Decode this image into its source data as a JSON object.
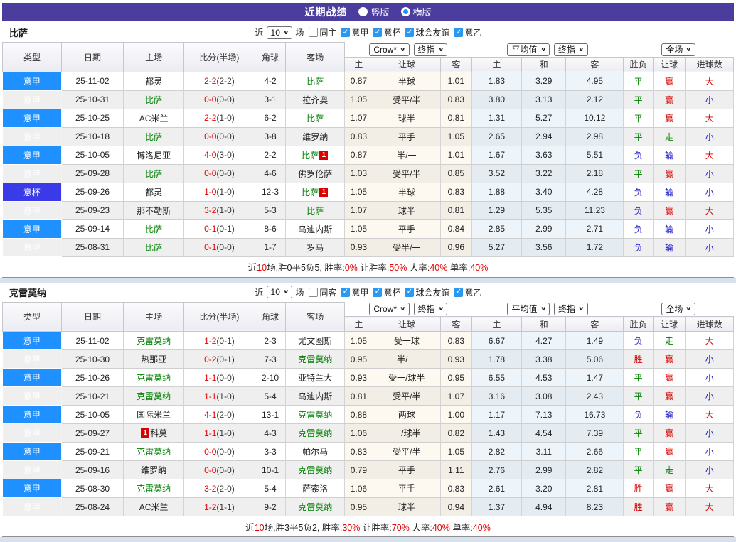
{
  "title_bar": {
    "title": "近期战绩",
    "options": [
      {
        "label": "竖版",
        "selected": false
      },
      {
        "label": "横版",
        "selected": true
      }
    ]
  },
  "colors": {
    "accent_purple": "#4a3d9e",
    "league_blue": "#1e90ff",
    "cup_blue": "#3a3ae8",
    "team_green": "#008000",
    "score_red": "#e60000",
    "win_red": "#d60000",
    "lose_blue": "#2323cc",
    "check_blue": "#2b99f0"
  },
  "table_header": {
    "main_cols": [
      "类型",
      "日期",
      "主场",
      "比分(半场)",
      "角球",
      "客场"
    ],
    "sub_cols": [
      "主",
      "让球",
      "客",
      "主",
      "和",
      "客",
      "胜负",
      "让球",
      "进球数"
    ],
    "selects": {
      "odds_source": "Crow*",
      "final1": "终指",
      "average": "平均值",
      "final2": "终指",
      "scope": "全场"
    }
  },
  "sections": [
    {
      "team": "比萨",
      "filter": {
        "near_label": "近",
        "count": "10",
        "games_label": "场",
        "same_label": "同主",
        "same_checked": false,
        "leagues": [
          "意甲",
          "意杯",
          "球会友谊",
          "意乙"
        ]
      },
      "rows": [
        {
          "type": "意甲",
          "cup": false,
          "date": "25-11-02",
          "home": "都灵",
          "home_green": false,
          "home_badge": "",
          "score": "2-2",
          "half": "(2-2)",
          "corner": "4-2",
          "away": "比萨",
          "away_green": true,
          "away_badge": "",
          "badge_pos": "after",
          "odds": [
            "0.87",
            "半球",
            "1.01"
          ],
          "avg": [
            "1.83",
            "3.29",
            "4.95"
          ],
          "res": [
            [
              "平",
              "g"
            ],
            [
              "赢",
              "r"
            ],
            [
              "大",
              "r"
            ]
          ]
        },
        {
          "type": "意甲",
          "cup": false,
          "date": "25-10-31",
          "home": "比萨",
          "home_green": true,
          "home_badge": "",
          "score": "0-0",
          "half": "(0-0)",
          "corner": "3-1",
          "away": "拉齐奥",
          "away_green": false,
          "away_badge": "",
          "badge_pos": "after",
          "odds": [
            "1.05",
            "受平/半",
            "0.83"
          ],
          "avg": [
            "3.80",
            "3.13",
            "2.12"
          ],
          "res": [
            [
              "平",
              "g"
            ],
            [
              "赢",
              "r"
            ],
            [
              "小",
              "b"
            ]
          ]
        },
        {
          "type": "意甲",
          "cup": false,
          "date": "25-10-25",
          "home": "AC米兰",
          "home_green": false,
          "home_badge": "",
          "score": "2-2",
          "half": "(1-0)",
          "corner": "6-2",
          "away": "比萨",
          "away_green": true,
          "away_badge": "",
          "badge_pos": "after",
          "odds": [
            "1.07",
            "球半",
            "0.81"
          ],
          "avg": [
            "1.31",
            "5.27",
            "10.12"
          ],
          "res": [
            [
              "平",
              "g"
            ],
            [
              "赢",
              "r"
            ],
            [
              "大",
              "r"
            ]
          ]
        },
        {
          "type": "意甲",
          "cup": false,
          "date": "25-10-18",
          "home": "比萨",
          "home_green": true,
          "home_badge": "",
          "score": "0-0",
          "half": "(0-0)",
          "corner": "3-8",
          "away": "维罗纳",
          "away_green": false,
          "away_badge": "",
          "badge_pos": "after",
          "odds": [
            "0.83",
            "平手",
            "1.05"
          ],
          "avg": [
            "2.65",
            "2.94",
            "2.98"
          ],
          "res": [
            [
              "平",
              "g"
            ],
            [
              "走",
              "g"
            ],
            [
              "小",
              "b"
            ]
          ]
        },
        {
          "type": "意甲",
          "cup": false,
          "date": "25-10-05",
          "home": "博洛尼亚",
          "home_green": false,
          "home_badge": "",
          "score": "4-0",
          "half": "(3-0)",
          "corner": "2-2",
          "away": "比萨",
          "away_green": true,
          "away_badge": "1",
          "badge_pos": "after",
          "odds": [
            "0.87",
            "半/一",
            "1.01"
          ],
          "avg": [
            "1.67",
            "3.63",
            "5.51"
          ],
          "res": [
            [
              "负",
              "b"
            ],
            [
              "输",
              "b"
            ],
            [
              "大",
              "r"
            ]
          ]
        },
        {
          "type": "意甲",
          "cup": false,
          "date": "25-09-28",
          "home": "比萨",
          "home_green": true,
          "home_badge": "",
          "score": "0-0",
          "half": "(0-0)",
          "corner": "4-6",
          "away": "佛罗伦萨",
          "away_green": false,
          "away_badge": "",
          "badge_pos": "after",
          "odds": [
            "1.03",
            "受平/半",
            "0.85"
          ],
          "avg": [
            "3.52",
            "3.22",
            "2.18"
          ],
          "res": [
            [
              "平",
              "g"
            ],
            [
              "赢",
              "r"
            ],
            [
              "小",
              "b"
            ]
          ]
        },
        {
          "type": "意杯",
          "cup": true,
          "date": "25-09-26",
          "home": "都灵",
          "home_green": false,
          "home_badge": "",
          "score": "1-0",
          "half": "(1-0)",
          "corner": "12-3",
          "away": "比萨",
          "away_green": true,
          "away_badge": "1",
          "badge_pos": "after",
          "odds": [
            "1.05",
            "半球",
            "0.83"
          ],
          "avg": [
            "1.88",
            "3.40",
            "4.28"
          ],
          "res": [
            [
              "负",
              "b"
            ],
            [
              "输",
              "b"
            ],
            [
              "小",
              "b"
            ]
          ]
        },
        {
          "type": "意甲",
          "cup": false,
          "date": "25-09-23",
          "home": "那不勒斯",
          "home_green": false,
          "home_badge": "",
          "score": "3-2",
          "half": "(1-0)",
          "corner": "5-3",
          "away": "比萨",
          "away_green": true,
          "away_badge": "",
          "badge_pos": "after",
          "odds": [
            "1.07",
            "球半",
            "0.81"
          ],
          "avg": [
            "1.29",
            "5.35",
            "11.23"
          ],
          "res": [
            [
              "负",
              "b"
            ],
            [
              "赢",
              "r"
            ],
            [
              "大",
              "r"
            ]
          ]
        },
        {
          "type": "意甲",
          "cup": false,
          "date": "25-09-14",
          "home": "比萨",
          "home_green": true,
          "home_badge": "",
          "score": "0-1",
          "half": "(0-1)",
          "corner": "8-6",
          "away": "乌迪内斯",
          "away_green": false,
          "away_badge": "",
          "badge_pos": "after",
          "odds": [
            "1.05",
            "平手",
            "0.84"
          ],
          "avg": [
            "2.85",
            "2.99",
            "2.71"
          ],
          "res": [
            [
              "负",
              "b"
            ],
            [
              "输",
              "b"
            ],
            [
              "小",
              "b"
            ]
          ]
        },
        {
          "type": "意甲",
          "cup": false,
          "date": "25-08-31",
          "home": "比萨",
          "home_green": true,
          "home_badge": "",
          "score": "0-1",
          "half": "(0-0)",
          "corner": "1-7",
          "away": "罗马",
          "away_green": false,
          "away_badge": "",
          "badge_pos": "after",
          "odds": [
            "0.93",
            "受半/一",
            "0.96"
          ],
          "avg": [
            "5.27",
            "3.56",
            "1.72"
          ],
          "res": [
            [
              "负",
              "b"
            ],
            [
              "输",
              "b"
            ],
            [
              "小",
              "b"
            ]
          ]
        }
      ],
      "summary": [
        [
          "近",
          "k"
        ],
        [
          "10",
          "r"
        ],
        [
          "场,胜0平5负5, 胜率:",
          "k"
        ],
        [
          "0%",
          "r"
        ],
        [
          " 让胜率:",
          "k"
        ],
        [
          "50%",
          "r"
        ],
        [
          " 大率:",
          "k"
        ],
        [
          "40%",
          "r"
        ],
        [
          " 单率:",
          "k"
        ],
        [
          "40%",
          "r"
        ]
      ]
    },
    {
      "team": "克雷莫纳",
      "filter": {
        "near_label": "近",
        "count": "10",
        "games_label": "场",
        "same_label": "同客",
        "same_checked": false,
        "leagues": [
          "意甲",
          "意杯",
          "球会友谊",
          "意乙"
        ]
      },
      "rows": [
        {
          "type": "意甲",
          "cup": false,
          "date": "25-11-02",
          "home": "克雷莫纳",
          "home_green": true,
          "home_badge": "",
          "score": "1-2",
          "half": "(0-1)",
          "corner": "2-3",
          "away": "尤文图斯",
          "away_green": false,
          "away_badge": "",
          "badge_pos": "after",
          "odds": [
            "1.05",
            "受一球",
            "0.83"
          ],
          "avg": [
            "6.67",
            "4.27",
            "1.49"
          ],
          "res": [
            [
              "负",
              "b"
            ],
            [
              "走",
              "g"
            ],
            [
              "大",
              "r"
            ]
          ]
        },
        {
          "type": "意甲",
          "cup": false,
          "date": "25-10-30",
          "home": "热那亚",
          "home_green": false,
          "home_badge": "",
          "score": "0-2",
          "half": "(0-1)",
          "corner": "7-3",
          "away": "克雷莫纳",
          "away_green": true,
          "away_badge": "",
          "badge_pos": "after",
          "odds": [
            "0.95",
            "半/一",
            "0.93"
          ],
          "avg": [
            "1.78",
            "3.38",
            "5.06"
          ],
          "res": [
            [
              "胜",
              "r"
            ],
            [
              "赢",
              "r"
            ],
            [
              "小",
              "b"
            ]
          ]
        },
        {
          "type": "意甲",
          "cup": false,
          "date": "25-10-26",
          "home": "克雷莫纳",
          "home_green": true,
          "home_badge": "",
          "score": "1-1",
          "half": "(0-0)",
          "corner": "2-10",
          "away": "亚特兰大",
          "away_green": false,
          "away_badge": "",
          "badge_pos": "after",
          "odds": [
            "0.93",
            "受一/球半",
            "0.95"
          ],
          "avg": [
            "6.55",
            "4.53",
            "1.47"
          ],
          "res": [
            [
              "平",
              "g"
            ],
            [
              "赢",
              "r"
            ],
            [
              "小",
              "b"
            ]
          ]
        },
        {
          "type": "意甲",
          "cup": false,
          "date": "25-10-21",
          "home": "克雷莫纳",
          "home_green": true,
          "home_badge": "",
          "score": "1-1",
          "half": "(1-0)",
          "corner": "5-4",
          "away": "乌迪内斯",
          "away_green": false,
          "away_badge": "",
          "badge_pos": "after",
          "odds": [
            "0.81",
            "受平/半",
            "1.07"
          ],
          "avg": [
            "3.16",
            "3.08",
            "2.43"
          ],
          "res": [
            [
              "平",
              "g"
            ],
            [
              "赢",
              "r"
            ],
            [
              "小",
              "b"
            ]
          ]
        },
        {
          "type": "意甲",
          "cup": false,
          "date": "25-10-05",
          "home": "国际米兰",
          "home_green": false,
          "home_badge": "",
          "score": "4-1",
          "half": "(2-0)",
          "corner": "13-1",
          "away": "克雷莫纳",
          "away_green": true,
          "away_badge": "",
          "badge_pos": "after",
          "odds": [
            "0.88",
            "两球",
            "1.00"
          ],
          "avg": [
            "1.17",
            "7.13",
            "16.73"
          ],
          "res": [
            [
              "负",
              "b"
            ],
            [
              "输",
              "b"
            ],
            [
              "大",
              "r"
            ]
          ]
        },
        {
          "type": "意甲",
          "cup": false,
          "date": "25-09-27",
          "home": "科莫",
          "home_green": false,
          "home_badge": "1",
          "score": "1-1",
          "half": "(1-0)",
          "corner": "4-3",
          "away": "克雷莫纳",
          "away_green": true,
          "away_badge": "",
          "badge_pos": "before",
          "odds": [
            "1.06",
            "一/球半",
            "0.82"
          ],
          "avg": [
            "1.43",
            "4.54",
            "7.39"
          ],
          "res": [
            [
              "平",
              "g"
            ],
            [
              "赢",
              "r"
            ],
            [
              "小",
              "b"
            ]
          ]
        },
        {
          "type": "意甲",
          "cup": false,
          "date": "25-09-21",
          "home": "克雷莫纳",
          "home_green": true,
          "home_badge": "",
          "score": "0-0",
          "half": "(0-0)",
          "corner": "3-3",
          "away": "帕尔马",
          "away_green": false,
          "away_badge": "",
          "badge_pos": "after",
          "odds": [
            "0.83",
            "受平/半",
            "1.05"
          ],
          "avg": [
            "2.82",
            "3.11",
            "2.66"
          ],
          "res": [
            [
              "平",
              "g"
            ],
            [
              "赢",
              "r"
            ],
            [
              "小",
              "b"
            ]
          ]
        },
        {
          "type": "意甲",
          "cup": false,
          "date": "25-09-16",
          "home": "维罗纳",
          "home_green": false,
          "home_badge": "",
          "score": "0-0",
          "half": "(0-0)",
          "corner": "10-1",
          "away": "克雷莫纳",
          "away_green": true,
          "away_badge": "",
          "badge_pos": "after",
          "odds": [
            "0.79",
            "平手",
            "1.11"
          ],
          "avg": [
            "2.76",
            "2.99",
            "2.82"
          ],
          "res": [
            [
              "平",
              "g"
            ],
            [
              "走",
              "g"
            ],
            [
              "小",
              "b"
            ]
          ]
        },
        {
          "type": "意甲",
          "cup": false,
          "date": "25-08-30",
          "home": "克雷莫纳",
          "home_green": true,
          "home_badge": "",
          "score": "3-2",
          "half": "(2-0)",
          "corner": "5-4",
          "away": "萨索洛",
          "away_green": false,
          "away_badge": "",
          "badge_pos": "after",
          "odds": [
            "1.06",
            "平手",
            "0.83"
          ],
          "avg": [
            "2.61",
            "3.20",
            "2.81"
          ],
          "res": [
            [
              "胜",
              "r"
            ],
            [
              "赢",
              "r"
            ],
            [
              "大",
              "r"
            ]
          ]
        },
        {
          "type": "意甲",
          "cup": false,
          "date": "25-08-24",
          "home": "AC米兰",
          "home_green": false,
          "home_badge": "",
          "score": "1-2",
          "half": "(1-1)",
          "corner": "9-2",
          "away": "克雷莫纳",
          "away_green": true,
          "away_badge": "",
          "badge_pos": "after",
          "odds": [
            "0.95",
            "球半",
            "0.94"
          ],
          "avg": [
            "1.37",
            "4.94",
            "8.23"
          ],
          "res": [
            [
              "胜",
              "r"
            ],
            [
              "赢",
              "r"
            ],
            [
              "大",
              "r"
            ]
          ]
        }
      ],
      "summary": [
        [
          "近",
          "k"
        ],
        [
          "10",
          "r"
        ],
        [
          "场,胜3平5负2, 胜率:",
          "k"
        ],
        [
          "30%",
          "r"
        ],
        [
          " 让胜率:",
          "k"
        ],
        [
          "70%",
          "r"
        ],
        [
          " 大率:",
          "k"
        ],
        [
          "40%",
          "r"
        ],
        [
          " 单率:",
          "k"
        ],
        [
          "40%",
          "r"
        ]
      ]
    }
  ]
}
